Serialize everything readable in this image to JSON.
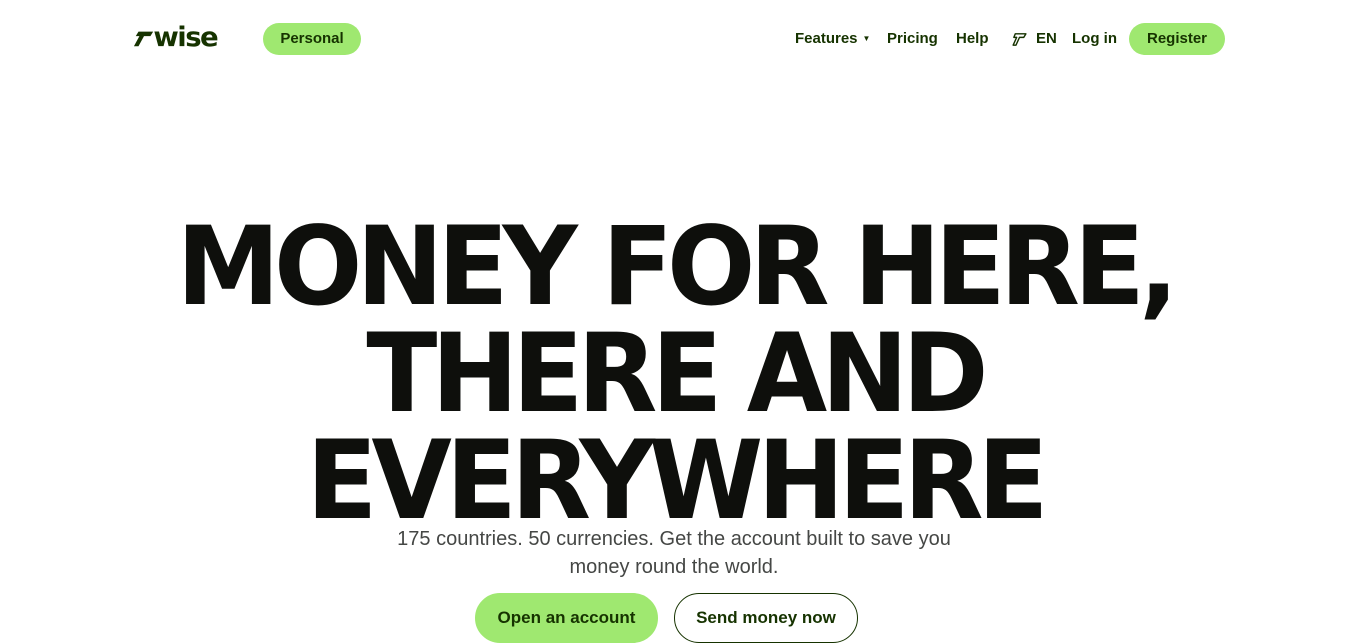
{
  "brand": {
    "name": "wise"
  },
  "nav": {
    "segment": "Personal",
    "links": {
      "features": "Features",
      "pricing": "Pricing",
      "help": "Help"
    },
    "language": "EN",
    "login": "Log in",
    "register": "Register"
  },
  "hero": {
    "headline": [
      "MONEY FOR HERE,",
      "THERE AND",
      "EVERYWHERE"
    ],
    "subtext": "175 countries. 50 currencies. Get the account built to save you money round the world.",
    "cta_primary": "Open an account",
    "cta_secondary": "Send money now"
  },
  "colors": {
    "accent": "#9fe870",
    "brand_dark": "#163300",
    "headline": "#0e0f0c"
  },
  "icons": {
    "logo": "wise-flag-icon",
    "features_dropdown": "chevron-down-icon",
    "language": "wise-flag-icon"
  }
}
